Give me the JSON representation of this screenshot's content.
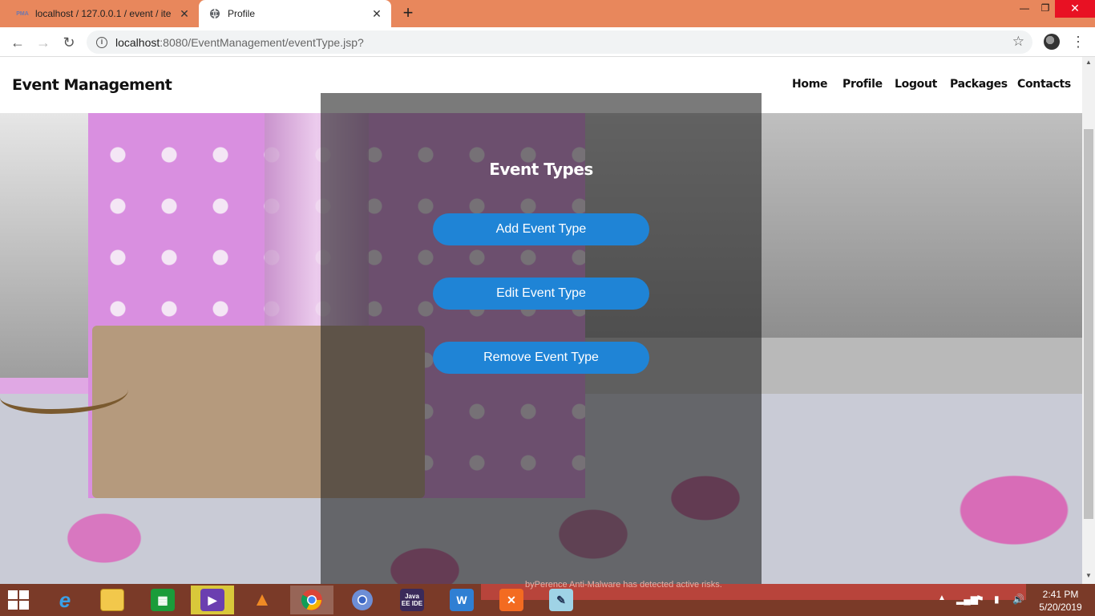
{
  "browser": {
    "tabs": [
      {
        "title": "localhost / 127.0.0.1 / event / ite",
        "icon": "phpmyadmin-icon",
        "active": false,
        "favicon_text": "PMA"
      },
      {
        "title": "Profile",
        "icon": "globe-icon",
        "active": true
      }
    ],
    "address": {
      "host": "localhost",
      "rest": ":8080/EventManagement/eventType.jsp?"
    }
  },
  "site": {
    "brand": "Event Management",
    "nav": [
      "Home",
      "Profile",
      "Logout",
      "Packages",
      "Contacts"
    ]
  },
  "panel": {
    "title": "Event Types",
    "buttons": [
      "Add Event Type",
      "Edit Event Type",
      "Remove Event Type"
    ],
    "button_color": "#1f84d6"
  },
  "taskbar": {
    "notification": "byPerence Anti-Malware has detected active risks.",
    "time": "2:41 PM",
    "date": "5/20/2019",
    "apps": [
      "internet-explorer-icon",
      "file-explorer-icon",
      "store-icon",
      "visual-studio-icon",
      "vlc-icon",
      "chrome-icon",
      "chromium-icon",
      "java-ee-ide-icon",
      "word-writer-icon",
      "xampp-icon",
      "notepad-icon"
    ],
    "java_label": "Java EE IDE"
  }
}
